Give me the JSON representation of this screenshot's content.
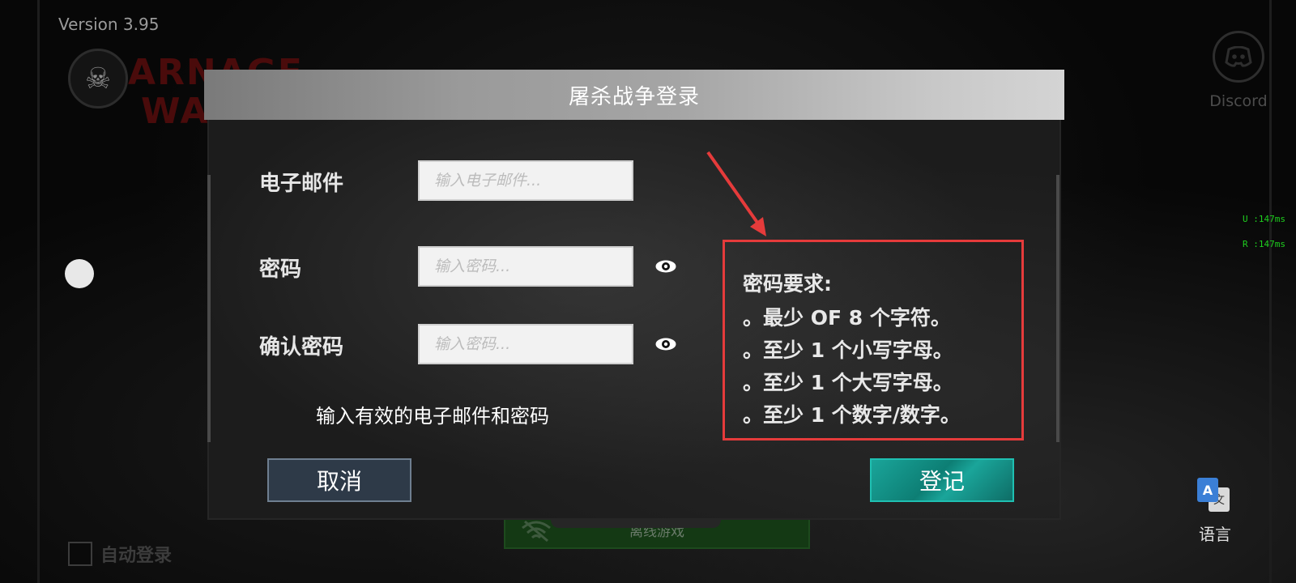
{
  "app": {
    "version": "Version 3.95",
    "logo_text_line1": "ARNAGE",
    "logo_text_line2": "WA",
    "discord_label": "Discord",
    "latency_u": "U :147ms",
    "latency_r": "R :147ms",
    "auto_login_label": "自动登录",
    "offline_label": "离线游戏",
    "language_label": "语言",
    "language_icon_letters": [
      "A",
      "文"
    ]
  },
  "dialog": {
    "title": "屠杀战争登录",
    "email_label": "电子邮件",
    "email_placeholder": "输入电子邮件...",
    "email_value": "",
    "password_label": "密码",
    "password_placeholder": "输入密码...",
    "password_value": "",
    "confirm_label": "确认密码",
    "confirm_placeholder": "输入密码...",
    "confirm_value": "",
    "hint": "输入有效的电子邮件和密码",
    "cancel_label": "取消",
    "register_label": "登记"
  },
  "requirements": {
    "title": "密码要求:",
    "items": [
      "。最少 OF 8 个字符。",
      "。至少 1 个小写字母。",
      "。至少 1 个大写字母。",
      "。至少 1 个数字/数字。"
    ]
  },
  "colors": {
    "highlight_box": "#e53b3b",
    "register_button": "#1aa59a",
    "cancel_button": "#2e3a48",
    "latency_text": "#1fd01f"
  },
  "icons": {
    "eye": "eye-icon",
    "discord": "discord-icon",
    "wifi": "wifi-icon",
    "translate": "translate-icon",
    "skull": "skull-icon"
  }
}
